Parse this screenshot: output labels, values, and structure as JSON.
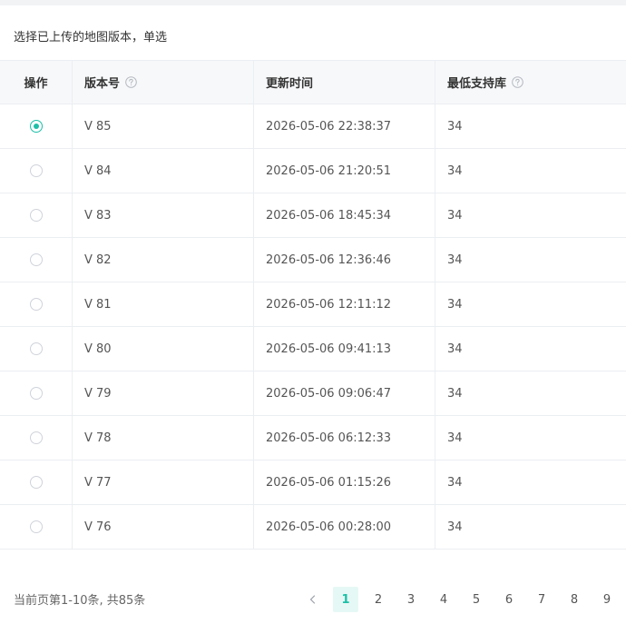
{
  "instruction": "选择已上传的地图版本，单选",
  "table": {
    "headers": {
      "op": "操作",
      "version": "版本号",
      "time": "更新时间",
      "min_lib": "最低支持库"
    },
    "rows": [
      {
        "selected": true,
        "version": "V 85",
        "time": "2026-05-06 22:38:37",
        "min_lib": "34"
      },
      {
        "selected": false,
        "version": "V 84",
        "time": "2026-05-06 21:20:51",
        "min_lib": "34"
      },
      {
        "selected": false,
        "version": "V 83",
        "time": "2026-05-06 18:45:34",
        "min_lib": "34"
      },
      {
        "selected": false,
        "version": "V 82",
        "time": "2026-05-06 12:36:46",
        "min_lib": "34"
      },
      {
        "selected": false,
        "version": "V 81",
        "time": "2026-05-06 12:11:12",
        "min_lib": "34"
      },
      {
        "selected": false,
        "version": "V 80",
        "time": "2026-05-06 09:41:13",
        "min_lib": "34"
      },
      {
        "selected": false,
        "version": "V 79",
        "time": "2026-05-06 09:06:47",
        "min_lib": "34"
      },
      {
        "selected": false,
        "version": "V 78",
        "time": "2026-05-06 06:12:33",
        "min_lib": "34"
      },
      {
        "selected": false,
        "version": "V 77",
        "time": "2026-05-06 01:15:26",
        "min_lib": "34"
      },
      {
        "selected": false,
        "version": "V 76",
        "time": "2026-05-06 00:28:00",
        "min_lib": "34"
      }
    ]
  },
  "footer": {
    "summary": "当前页第1-10条, 共85条",
    "pages": [
      "1",
      "2",
      "3",
      "4",
      "5",
      "6",
      "7",
      "8",
      "9"
    ],
    "current_page": "1"
  },
  "colors": {
    "accent": "#1cbfa8",
    "accent_bg": "#e6f8f5",
    "border": "#ebeef2",
    "header_bg": "#f7f8fa"
  },
  "icons": {
    "help": "help-circle-icon",
    "prev": "chevron-left-icon"
  }
}
